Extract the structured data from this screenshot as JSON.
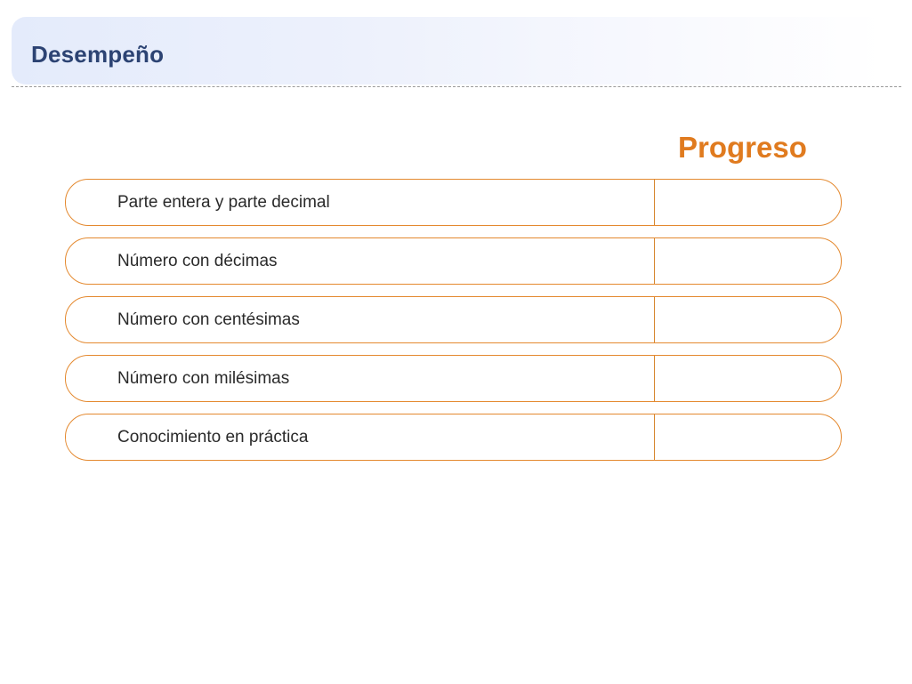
{
  "header": {
    "title": "Desempeño"
  },
  "progress": {
    "heading": "Progreso"
  },
  "topics": [
    {
      "label": "Parte entera y parte decimal"
    },
    {
      "label": "Número con décimas"
    },
    {
      "label": "Número con centésimas"
    },
    {
      "label": "Número con milésimas"
    },
    {
      "label": "Conocimiento en práctica"
    }
  ],
  "colors": {
    "title": "#2c4373",
    "accent": "#e07b1f",
    "row_border": "#e4892f"
  }
}
